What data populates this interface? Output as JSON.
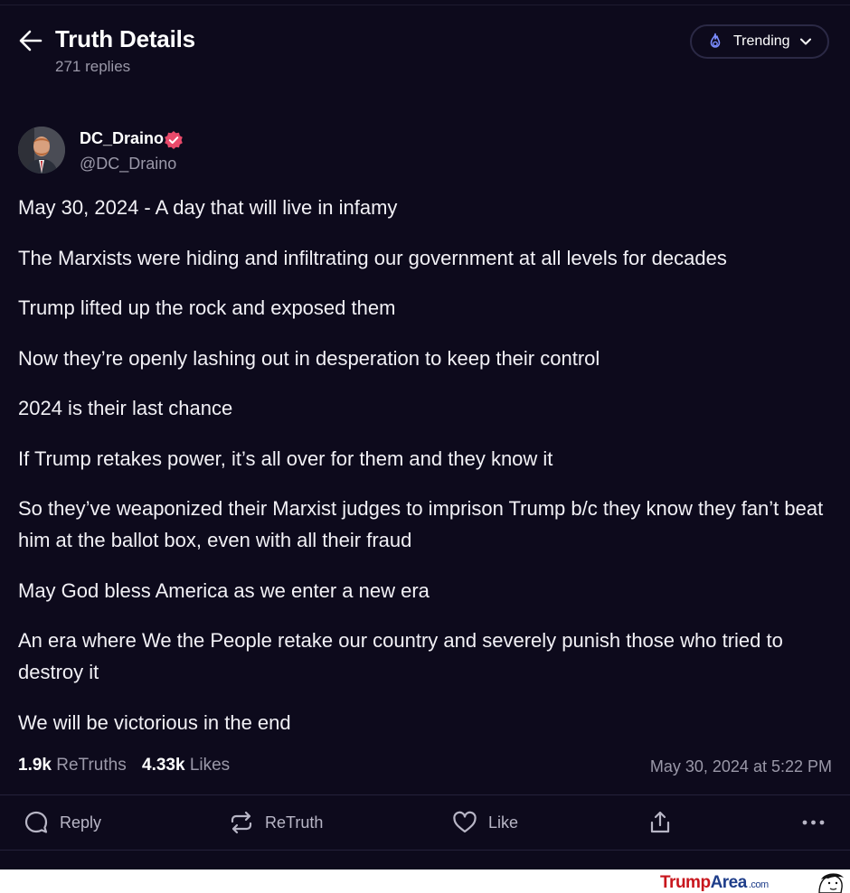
{
  "header": {
    "title": "Truth Details",
    "replies": "271 replies",
    "sort_label": "Trending"
  },
  "author": {
    "display_name": "DC_Draino",
    "handle": "@DC_Draino"
  },
  "post": {
    "paragraphs": [
      "May 30, 2024 - A day that will live in infamy",
      "The Marxists were hiding and infiltrating our government at all levels for decades",
      "Trump lifted up the rock and exposed them",
      "Now they’re openly lashing out in desperation to keep their control",
      "2024 is their last chance",
      "If Trump retakes power, it’s all over for them and they know it",
      "So they’ve weaponized their Marxist judges to imprison Trump b/c they know they fan’t beat him at the ballot box, even with all their fraud",
      "May God bless America as we enter a new era",
      "An era where We the People retake our country and severely punish those who tried to destroy it",
      "We will be victorious in the end"
    ]
  },
  "stats": {
    "retruths_count": "1.9k",
    "retruths_label": "ReTruths",
    "likes_count": "4.33k",
    "likes_label": "Likes",
    "timestamp": "May 30, 2024 at 5:22 PM"
  },
  "actions": {
    "reply": "Reply",
    "retruth": "ReTruth",
    "like": "Like"
  },
  "watermark": {
    "part1": "Trump",
    "part2": "Area",
    "part3": ".com"
  },
  "colors": {
    "background": "#0d0a1c",
    "verified_badge": "#e8496a",
    "trending_icon": "#7b8cff",
    "muted_text": "#9a98a8"
  },
  "icons": {
    "back": "arrow-left-icon",
    "trending": "flame-icon",
    "dropdown": "chevron-down-icon",
    "verified": "verified-badge-icon",
    "reply": "chat-bubble-icon",
    "retruth": "repeat-arrows-icon",
    "like": "heart-icon",
    "share": "share-upload-icon",
    "more": "ellipsis-icon"
  }
}
